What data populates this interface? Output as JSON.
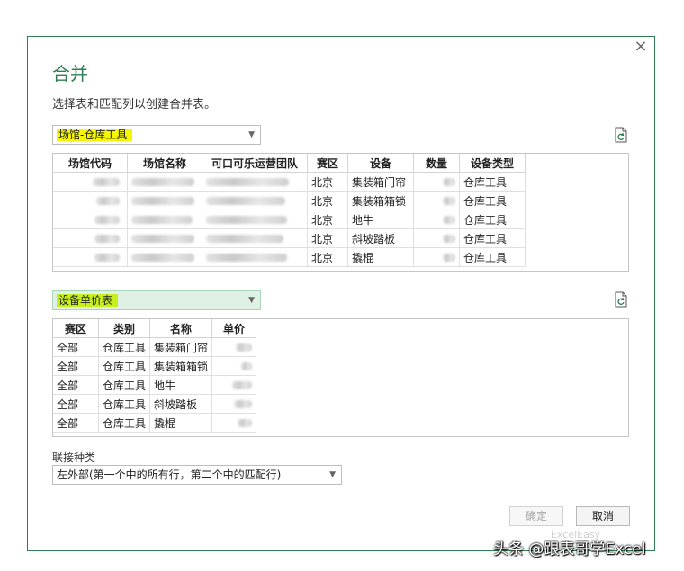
{
  "dialog": {
    "close_symbol": "×",
    "title": "合并",
    "subtitle": "选择表和匹配列以创建合并表。"
  },
  "table1": {
    "selected": "场馆-仓库工具",
    "columns": [
      "场馆代码",
      "场馆名称",
      "可口可乐运营团队",
      "赛区",
      "设备",
      "数量",
      "设备类型"
    ],
    "rows": [
      {
        "region": "北京",
        "device": "集装箱门帘",
        "type": "仓库工具"
      },
      {
        "region": "北京",
        "device": "集装箱箱锁",
        "type": "仓库工具"
      },
      {
        "region": "北京",
        "device": "地牛",
        "type": "仓库工具"
      },
      {
        "region": "北京",
        "device": "斜坡踏板",
        "type": "仓库工具"
      },
      {
        "region": "北京",
        "device": "撬棍",
        "type": "仓库工具"
      }
    ]
  },
  "table2": {
    "selected": "设备单价表",
    "columns": [
      "赛区",
      "类别",
      "名称",
      "单价"
    ],
    "rows": [
      {
        "region": "全部",
        "category": "仓库工具",
        "name": "集装箱门帘"
      },
      {
        "region": "全部",
        "category": "仓库工具",
        "name": "集装箱箱锁"
      },
      {
        "region": "全部",
        "category": "仓库工具",
        "name": "地牛"
      },
      {
        "region": "全部",
        "category": "仓库工具",
        "name": "斜坡踏板"
      },
      {
        "region": "全部",
        "category": "仓库工具",
        "name": "撬棍"
      }
    ]
  },
  "join": {
    "label": "联接种类",
    "selected": "左外部(第一个中的所有行，第二个中的匹配行)"
  },
  "buttons": {
    "ok": "确定",
    "cancel": "取消"
  },
  "watermark": {
    "text": "头条 @跟表哥学Excel",
    "faint": "ExcelEasy"
  },
  "colors": {
    "accent": "#2f7d52",
    "highlight_yellow": "#f6f600",
    "highlight_lime": "#c7ef20"
  }
}
